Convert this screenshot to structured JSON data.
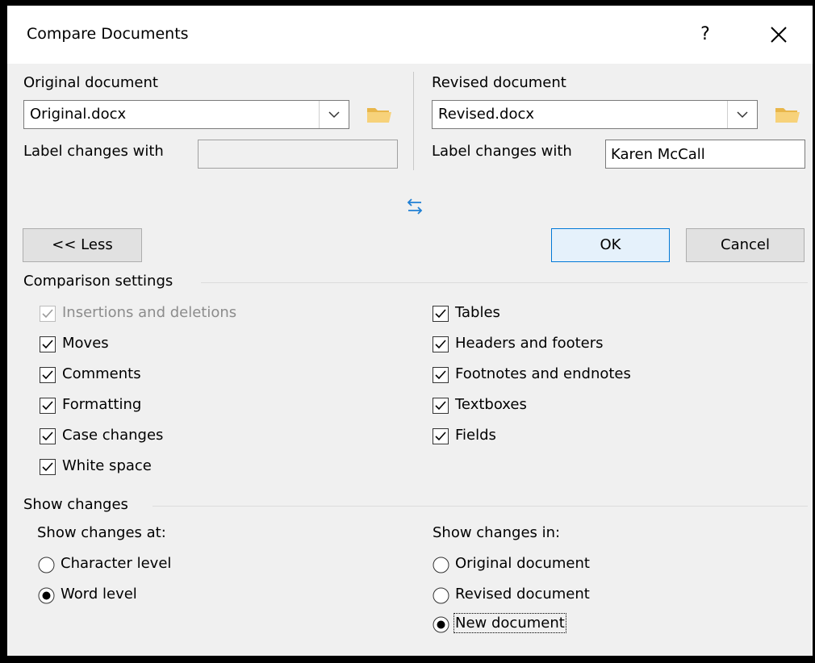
{
  "dialog": {
    "title": "Compare Documents",
    "help_label": "?",
    "close_icon": "close-icon"
  },
  "original": {
    "heading": "Original document",
    "file": "Original.docx",
    "label_changes_with": "Label changes with",
    "label_value": ""
  },
  "revised": {
    "heading": "Revised document",
    "file": "Revised.docx",
    "label_changes_with": "Label changes with",
    "label_value": "Karen McCall"
  },
  "buttons": {
    "less": "<< Less",
    "ok": "OK",
    "cancel": "Cancel"
  },
  "comparison": {
    "title": "Comparison settings",
    "left": [
      {
        "label": "Insertions and deletions",
        "checked": true,
        "disabled": true
      },
      {
        "label": "Moves",
        "checked": true
      },
      {
        "label": "Comments",
        "checked": true
      },
      {
        "label": "Formatting",
        "checked": true
      },
      {
        "label": "Case changes",
        "checked": true
      },
      {
        "label": "White space",
        "checked": true
      }
    ],
    "right": [
      {
        "label": "Tables",
        "checked": true
      },
      {
        "label": "Headers and footers",
        "checked": true
      },
      {
        "label": "Footnotes and endnotes",
        "checked": true
      },
      {
        "label": "Textboxes",
        "checked": true
      },
      {
        "label": "Fields",
        "checked": true
      }
    ]
  },
  "show_changes": {
    "title": "Show changes",
    "at_label": "Show changes at:",
    "at_options": [
      {
        "label": "Character level",
        "selected": false
      },
      {
        "label": "Word level",
        "selected": true
      }
    ],
    "in_label": "Show changes in:",
    "in_options": [
      {
        "label": "Original document",
        "selected": false
      },
      {
        "label": "Revised document",
        "selected": false
      },
      {
        "label": "New document",
        "selected": true
      }
    ]
  },
  "colors": {
    "dialog_bg": "#f0f0f0",
    "ok_border": "#0078d7",
    "swap_arrow": "#1f7fd4",
    "folder": "#e8b64a"
  }
}
